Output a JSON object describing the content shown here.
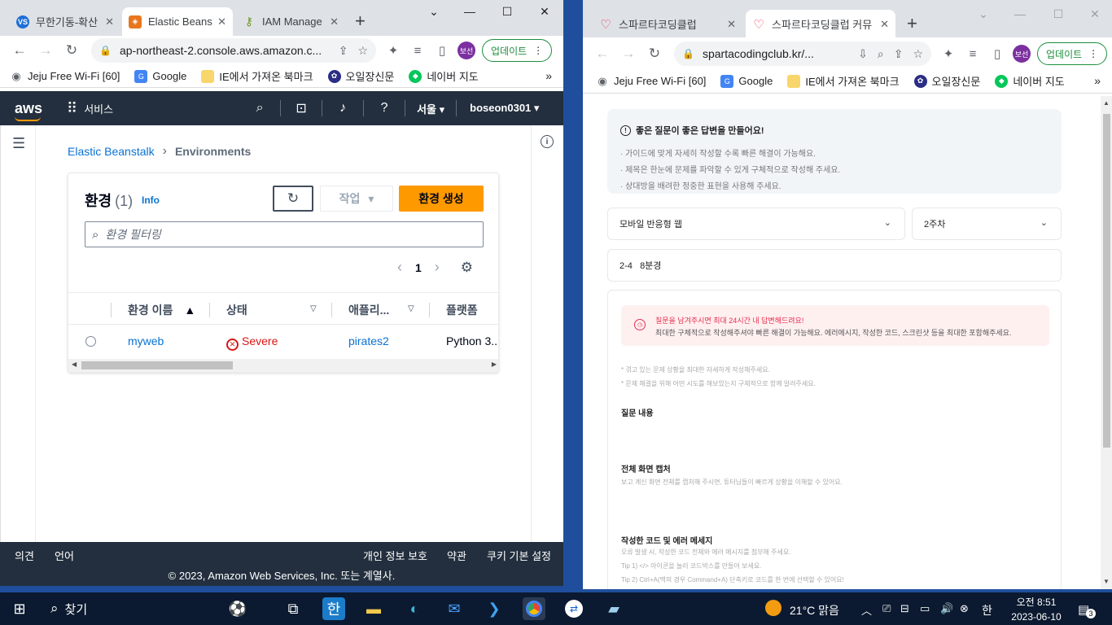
{
  "left_window": {
    "tabs": [
      {
        "title": "무한기동-확산",
        "icon": "vs-icon",
        "active": false
      },
      {
        "title": "Elastic Beanstalk",
        "icon": "aws-icon",
        "active": true
      },
      {
        "title": "IAM Manage",
        "icon": "iam-icon",
        "active": false
      }
    ],
    "url": "ap-northeast-2.console.aws.amazon.c...",
    "profile": "보선",
    "update_label": "업데이트",
    "bookmarks": [
      {
        "label": "Jeju Free Wi-Fi [60]"
      },
      {
        "label": "Google"
      },
      {
        "label": "IE에서 가져온 북마크"
      },
      {
        "label": "오일장신문"
      },
      {
        "label": "네이버 지도"
      }
    ]
  },
  "aws": {
    "logo": "aws",
    "services": "서비스",
    "region": "서울",
    "account": "boseon0301",
    "breadcrumb": {
      "link": "Elastic Beanstalk",
      "current": "Environments"
    },
    "panel": {
      "title": "환경",
      "count": "(1)",
      "info": "Info",
      "actions_label": "작업",
      "create_label": "환경 생성",
      "filter_placeholder": "환경 필터링",
      "page": "1"
    },
    "table": {
      "columns": [
        "환경 이름",
        "상태",
        "애플리...",
        "플랫폼"
      ],
      "rows": [
        {
          "name": "myweb",
          "status": "Severe",
          "application": "pirates2",
          "platform": "Python 3..."
        }
      ]
    },
    "footer": {
      "feedback": "의견",
      "language": "언어",
      "privacy": "개인 정보 보호",
      "terms": "약관",
      "cookies": "쿠키 기본 설정",
      "copyright": "© 2023, Amazon Web Services, Inc. 또는 계열사."
    }
  },
  "right_window": {
    "tabs": [
      {
        "title": "스파르타코딩클럽",
        "active": false
      },
      {
        "title": "스파르타코딩클럽 커뮤",
        "active": true
      }
    ],
    "url": "spartacodingclub.kr/...",
    "profile": "보선",
    "update_label": "업데이트",
    "bookmarks": [
      {
        "label": "Jeju Free Wi-Fi [60]"
      },
      {
        "label": "Google"
      },
      {
        "label": "IE에서 가져온 북마크"
      },
      {
        "label": "오일장신문"
      },
      {
        "label": "네이버 지도"
      }
    ]
  },
  "sparta": {
    "guide_title": "좋은 질문이 좋은 답변을 만들어요!",
    "guide_lines": [
      "· 가이드에 맞게 자세히 작성할 수록 빠른 해결이 가능해요.",
      "· 제목은 한눈에 문제를 파악할 수 있게 구체적으로 작성해 주세요.",
      "· 상대방을 배려한 정중한 표현을 사용해 주세요."
    ],
    "course_select": "모바일 반응형 웹",
    "week_select": "2주차",
    "title_value": "2-4   8분경",
    "alert_title": "질문을 남겨주시면 최대 24시간 내 답변해드려요!",
    "alert_body": "최대한 구체적으로 작성해주셔야 빠른 해결이 가능해요. 에러메시지, 작성한 코드, 스크린샷 등을 최대한 포함해주세요.",
    "hint1": "* 겪고 있는 문제 상황을 최대한 자세하게 작성해주세요.",
    "hint2": "* 문제 해결을 위해 어떤 시도를 해보았는지 구체적으로 함께 알려주세요.",
    "section1": "질문 내용",
    "section2": "전체 화면 캡처",
    "section2_sub": "보고 계신 화면 전체를 캡처해 주시면, 튜터님들이 빠르게 상황을 이해할 수 있어요.",
    "section3": "작성한 코드 및 에러 메세지",
    "section3_sub1": "오류 발생 시, 작성한 코드 전체와 에러 메시지를 첨부해 주세요.",
    "section3_sub2": "Tip 1) </> 아이콘을 눌러 코드박스를 만들어 보세요.",
    "section3_sub3": "Tip 2) Ctrl+A(맥의 경우 Command+A) 단축키로 코드를 한 번에 선택할 수 있어요!"
  },
  "taskbar": {
    "search": "찾기",
    "weather": "21°C  맑음",
    "ime": "한",
    "time": "오전 8:51",
    "date": "2023-06-10",
    "notifications": "3"
  }
}
